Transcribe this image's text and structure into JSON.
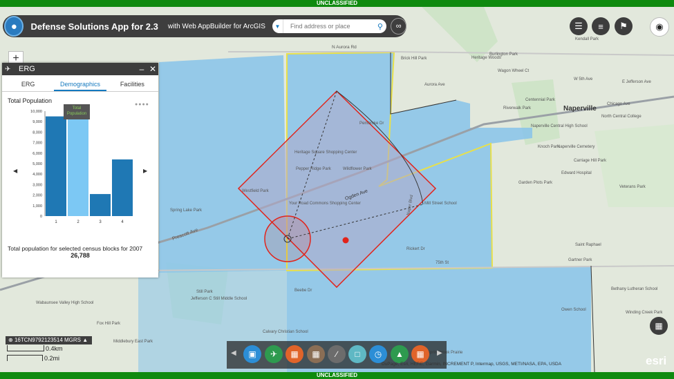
{
  "classification": "UNCLASSIFIED",
  "header": {
    "title": "Defense Solutions App for 2.3",
    "subtitle": "with Web AppBuilder for ArcGIS",
    "search_placeholder": "Find address or place"
  },
  "widget": {
    "title": "ERG",
    "tabs": [
      "ERG",
      "Demographics",
      "Facilities"
    ],
    "active_tab": "Demographics",
    "metric_label": "Total Population",
    "tooltip": "Total Population",
    "caption": "Total population for selected census blocks for 2007",
    "total": "26,788"
  },
  "chart_data": {
    "type": "bar",
    "categories": [
      "1",
      "2",
      "3",
      "4"
    ],
    "values": [
      9500,
      9450,
      2100,
      5400
    ],
    "highlighted_category": "2",
    "yticks": [
      "0",
      "1,000",
      "2,000",
      "3,000",
      "4,000",
      "5,000",
      "6,000",
      "7,000",
      "8,000",
      "9,000",
      "10,000"
    ],
    "ylim": [
      0,
      10000
    ]
  },
  "map": {
    "labels": [
      "Naperville",
      "Burlington Park",
      "Kendall Park",
      "Heritage Woods",
      "Centennial Park",
      "Riverwalk Park",
      "Naperville Central High School",
      "North Central College",
      "Knoch Park",
      "Naperville Cemetery",
      "Edward Hospital",
      "Garden Plots Park",
      "Veterans Park",
      "Springbrook Prairie",
      "Wabaunsee Valley High School",
      "Jefferson C Still Middle School",
      "Calvary Christian School",
      "Spring Lake Park",
      "Westfield Park",
      "Saint Raphael",
      "Gartner Park",
      "Bethany Lutheran School",
      "Owen School",
      "Winding Creek Park",
      "Middlebury East Park",
      "Mill Street School",
      "Still Park",
      "Brick Hill Park",
      "Heritage Square Shopping Center",
      "Pepper Ridge Park",
      "Your Road Commons Shopping Center",
      "Wildflower Park",
      "Fox Hill Park",
      "N Aurora Rd",
      "Ogden Ave",
      "Prescott Ave",
      "75th St",
      "Beebe Dr",
      "Naper Blvd",
      "Rickert Dr",
      "W 5th Ave",
      "Chicago Ave",
      "E Jefferson Ave",
      "Wagon Wheel Ct",
      "Carriage Hill Park",
      "Pembroke Dr",
      "Aurora Ave"
    ]
  },
  "coordinates": "16TCN9792123514 MGRS",
  "scale": {
    "km": "0.4km",
    "mi": "0.2mi"
  },
  "toolbar_icons": [
    "sketch-icon",
    "route-icon",
    "table-icon",
    "grid-icon",
    "line-icon",
    "coordinate-icon",
    "clock-icon",
    "elevation-icon",
    "dashboard-icon"
  ],
  "attribution": "DuPage, Esri, HERE, Garmin, INCREMENT P, Intermap, USGS, METI/NASA, EPA, USDA",
  "esri_logo": "esri"
}
